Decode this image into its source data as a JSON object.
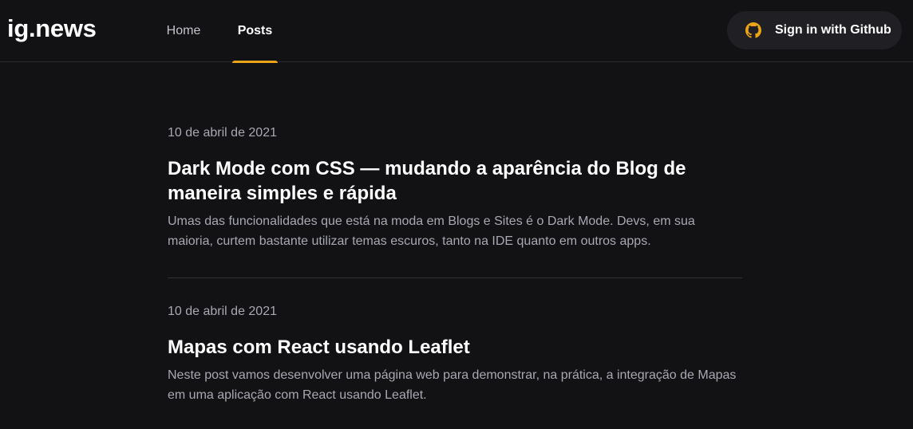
{
  "header": {
    "logo": "ig.news",
    "nav": [
      {
        "label": "Home"
      },
      {
        "label": "Posts",
        "active": true
      }
    ],
    "signin": {
      "label": "Sign in with Github",
      "icon": "github-icon",
      "icon_color": "#eba417"
    },
    "accent_color": "#eba417"
  },
  "posts": [
    {
      "date": "10 de abril de 2021",
      "title": "Dark Mode com CSS — mudando a aparência do Blog de maneira simples e rápida",
      "excerpt": "Umas das funcionalidades que está na moda em Blogs e Sites é o Dark Mode. Devs, em sua maioria, curtem bastante utilizar temas escuros, tanto na IDE quanto em outros apps."
    },
    {
      "date": "10 de abril de 2021",
      "title": "Mapas com React usando Leaflet",
      "excerpt": "Neste post vamos desenvolver uma página web para demonstrar, na prática, a integração de Mapas em uma aplicação com React usando Leaflet."
    }
  ]
}
